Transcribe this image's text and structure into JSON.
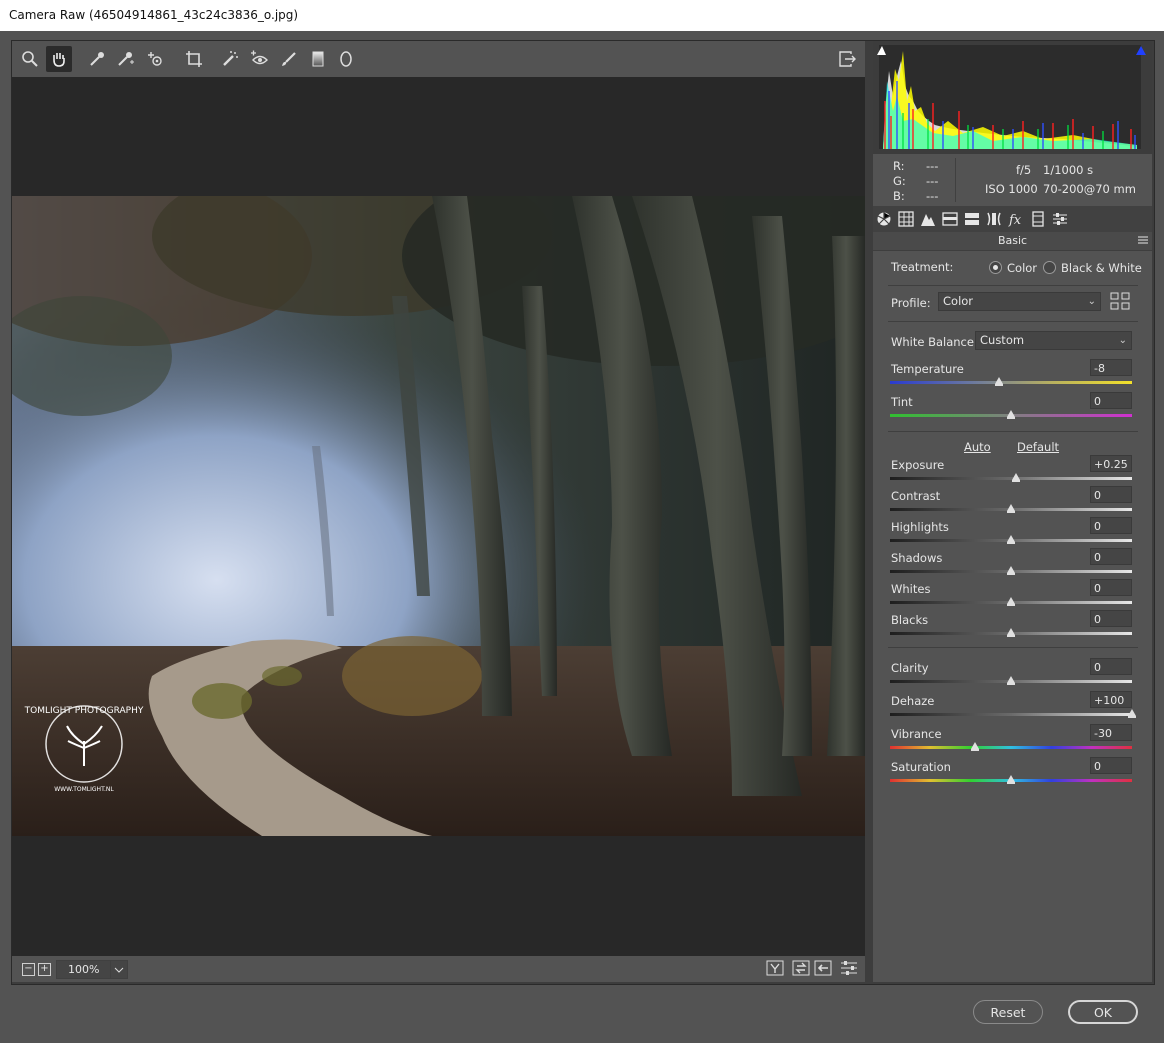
{
  "window": {
    "title": "Camera Raw (46504914861_43c24c3836_o.jpg)"
  },
  "toolbar": {
    "tools": [
      "zoom-icon",
      "hand-icon",
      "white-balance-icon",
      "color-sampler-icon",
      "targeted-adjustment-icon",
      "crop-icon",
      "spot-removal-icon",
      "red-eye-icon",
      "adjustment-brush-icon",
      "graduated-filter-icon",
      "radial-filter-icon"
    ],
    "active_tool": "hand-icon",
    "right_icon": "open-preferences-icon"
  },
  "bottombar": {
    "zoom_value": "100%",
    "zoom_out": "−",
    "zoom_in": "+"
  },
  "histogram": {
    "r": "---",
    "g": "---",
    "b": "---",
    "aperture": "f/5",
    "shutter": "1/1000 s",
    "iso": "ISO 1000",
    "lens": "70-200@70 mm",
    "r_label": "R:",
    "g_label": "G:",
    "b_label": "B:"
  },
  "panel": {
    "title": "Basic",
    "treatment_label": "Treatment:",
    "treatment_color": "Color",
    "treatment_bw": "Black & White",
    "profile_label": "Profile:",
    "profile_value": "Color",
    "wb_label": "White Balance:",
    "wb_value": "Custom",
    "auto": "Auto",
    "default": "Default",
    "sliders": [
      {
        "label": "Temperature",
        "value": "-8",
        "pos": 0.45,
        "gradient": "temp"
      },
      {
        "label": "Tint",
        "value": "0",
        "pos": 0.5,
        "gradient": "tint"
      },
      {
        "label": "Exposure",
        "value": "+0.25",
        "pos": 0.52,
        "gradient": "gray"
      },
      {
        "label": "Contrast",
        "value": "0",
        "pos": 0.5,
        "gradient": "gray"
      },
      {
        "label": "Highlights",
        "value": "0",
        "pos": 0.5,
        "gradient": "gray"
      },
      {
        "label": "Shadows",
        "value": "0",
        "pos": 0.5,
        "gradient": "gray"
      },
      {
        "label": "Whites",
        "value": "0",
        "pos": 0.5,
        "gradient": "gray"
      },
      {
        "label": "Blacks",
        "value": "0",
        "pos": 0.5,
        "gradient": "gray"
      },
      {
        "label": "Clarity",
        "value": "0",
        "pos": 0.5,
        "gradient": "gray"
      },
      {
        "label": "Dehaze",
        "value": "+100",
        "pos": 1.0,
        "gradient": "gray"
      },
      {
        "label": "Vibrance",
        "value": "-30",
        "pos": 0.35,
        "gradient": "rainbow"
      },
      {
        "label": "Saturation",
        "value": "0",
        "pos": 0.5,
        "gradient": "rainbow"
      }
    ]
  },
  "buttons": {
    "reset": "Reset",
    "ok": "OK"
  },
  "watermark": {
    "text": "TOMLIGHT PHOTOGRAPHY",
    "url": "WWW.TOMLIGHT.NL"
  }
}
